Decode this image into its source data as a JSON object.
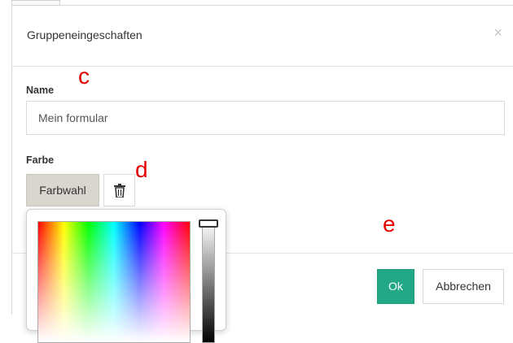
{
  "dialog": {
    "title": "Gruppeneingeschaften",
    "close_glyph": "×"
  },
  "form": {
    "name_label": "Name",
    "name_value": "Mein formular",
    "color_label": "Farbe",
    "color_button_label": "Farbwahl"
  },
  "footer": {
    "ok_label": "Ok",
    "cancel_label": "Abbrechen"
  },
  "annotations": {
    "c": "c",
    "d": "d",
    "e": "e"
  },
  "icons": {
    "trash": "trash-icon",
    "close": "close-icon"
  },
  "colors": {
    "ok_button": "#23a887",
    "color_button": "#d9d6cf",
    "annotation": "#e40000"
  }
}
